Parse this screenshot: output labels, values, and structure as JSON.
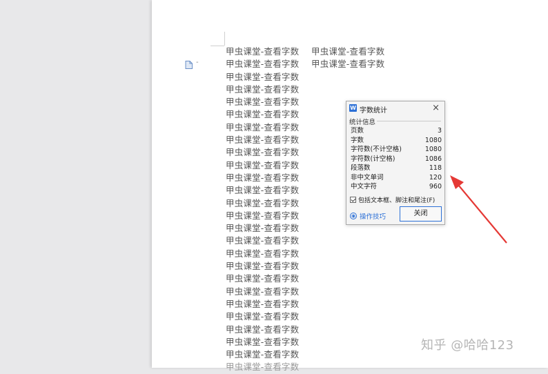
{
  "document": {
    "line_text": "甲虫课堂-查看字数",
    "column2_lines": [
      "甲虫课堂-查看字数",
      "甲虫课堂-查看字数"
    ],
    "column1_count": 26,
    "para_marker": "-"
  },
  "dialog": {
    "title": "字数统计",
    "close_glyph": "×",
    "section_label": "统计信息",
    "stats": [
      {
        "label": "页数",
        "value": "3"
      },
      {
        "label": "字数",
        "value": "1080"
      },
      {
        "label": "字符数(不计空格)",
        "value": "1080"
      },
      {
        "label": "字符数(计空格)",
        "value": "1086"
      },
      {
        "label": "段落数",
        "value": "118"
      },
      {
        "label": "非中文单词",
        "value": "120"
      },
      {
        "label": "中文字符",
        "value": "960"
      }
    ],
    "include_label": "包括文本框、脚注和尾注(F)",
    "include_checked": true,
    "tips_label": "操作技巧",
    "close_button_label": "关闭",
    "accent_color": "#2b6fd6"
  },
  "annotation": {
    "arrow_color": "#e53935"
  },
  "watermark": "知乎 @哈哈123"
}
